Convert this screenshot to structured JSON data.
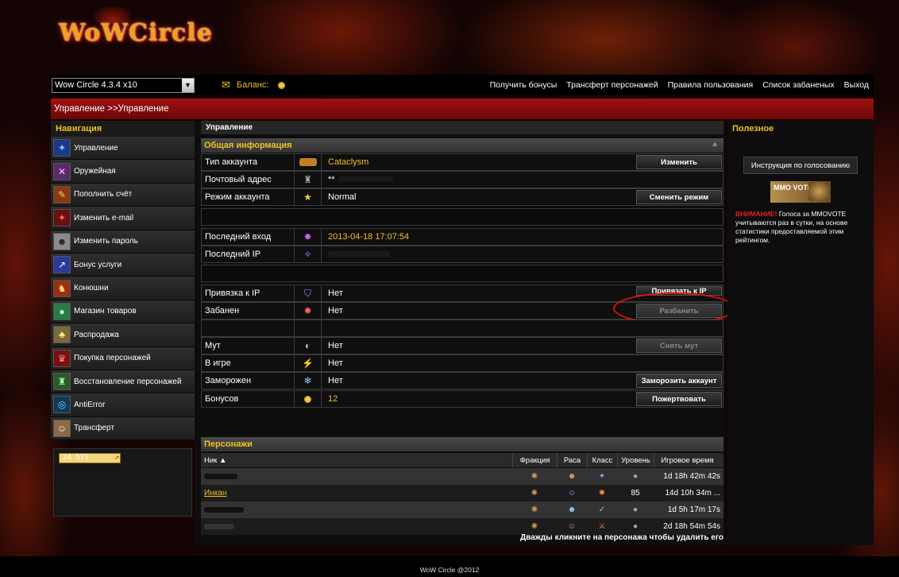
{
  "brand": {
    "logo_text": "WoWCircle"
  },
  "topbar": {
    "server_value": "Wow Circle 4.3.4 x10",
    "balance_label": "Баланс:",
    "links": [
      "Получить бонусы",
      "Трансферт персонажей",
      "Правила пользования",
      "Список забаненых",
      "Выход"
    ]
  },
  "breadcrumb": "Управление >>Управление",
  "nav": {
    "title": "Навигация",
    "items": [
      {
        "label": "Управление",
        "icon": "management-icon"
      },
      {
        "label": "Оружейная",
        "icon": "armory-icon"
      },
      {
        "label": "Пополнить счёт",
        "icon": "deposit-icon"
      },
      {
        "label": "Изменить e-mail",
        "icon": "email-icon"
      },
      {
        "label": "Изменить пароль",
        "icon": "password-icon"
      },
      {
        "label": "Бонус услуги",
        "icon": "bonus-icon"
      },
      {
        "label": "Конюшни",
        "icon": "stable-icon"
      },
      {
        "label": "Магазин товаров",
        "icon": "shop-icon"
      },
      {
        "label": "Распродажа",
        "icon": "sale-icon"
      },
      {
        "label": "Покупка персонажей",
        "icon": "buy-character-icon"
      },
      {
        "label": "Восстановление персонажей",
        "icon": "restore-character-icon"
      },
      {
        "label": "AntiError",
        "icon": "antierror-icon"
      },
      {
        "label": "Трансферт",
        "icon": "transfer-icon"
      }
    ],
    "counter": "24 571"
  },
  "main": {
    "tab": "Управление",
    "general_title": "Общая информация",
    "rows": {
      "account_type": {
        "label": "Тип аккаунта",
        "value": "Cataclysm",
        "button": "Изменить"
      },
      "email": {
        "label": "Почтовый адрес",
        "value": "**"
      },
      "mode": {
        "label": "Режим аккаунта",
        "value": "Normal",
        "button": "Сменить режим"
      },
      "last_login": {
        "label": "Последний вход",
        "value": "2013-04-18 17:07:54"
      },
      "last_ip": {
        "label": "Последний IP"
      },
      "ip_bind": {
        "label": "Привязка к IP",
        "value": "Нет",
        "button": "Привязать к IP"
      },
      "banned": {
        "label": "Забанен",
        "value": "Нет",
        "button": "Разбанить"
      },
      "mute": {
        "label": "Мут",
        "value": "Нет",
        "button": "Снять мут"
      },
      "in_game": {
        "label": "В игре",
        "value": "Нет"
      },
      "frozen": {
        "label": "Заморожен",
        "value": "Нет",
        "button": "Заморозить аккаунт"
      },
      "bonuses": {
        "label": "Бонусов",
        "value": "12",
        "button": "Пожертвовать"
      }
    },
    "characters": {
      "title": "Персонажи",
      "columns": {
        "name": "Ник ▲",
        "faction": "Фракция",
        "race": "Раса",
        "class": "Класс",
        "level": "Уровень",
        "playtime": "Игровое время"
      },
      "rows": [
        {
          "name": "",
          "level": "",
          "playtime": "1d 18h 42m 42s"
        },
        {
          "name": "Инкан",
          "level": "85",
          "playtime": "14d 10h 34m ..."
        },
        {
          "name": "",
          "level": "",
          "playtime": "1d 5h 17m 17s"
        },
        {
          "name": "",
          "level": "",
          "playtime": "2d 18h 54m 54s"
        }
      ],
      "hint": "Дважды кликните на персонажа чтобы удалить его"
    }
  },
  "right": {
    "title": "Полезное",
    "vote_button": "Инструкция по голосованию",
    "mmo_banner": "MMO VOTE",
    "warning_label": "ВНИМАНИЕ!",
    "warning_text": " Голоса за MMOVOTE учитываются раз в сутки, на основе статистики предоставляемой этим рейтингом."
  },
  "footer": "WoW Circle @2012",
  "colors": {
    "accent_gold": "#f0c020",
    "crumb_red": "#a01010",
    "annotation_red": "#e01010"
  }
}
